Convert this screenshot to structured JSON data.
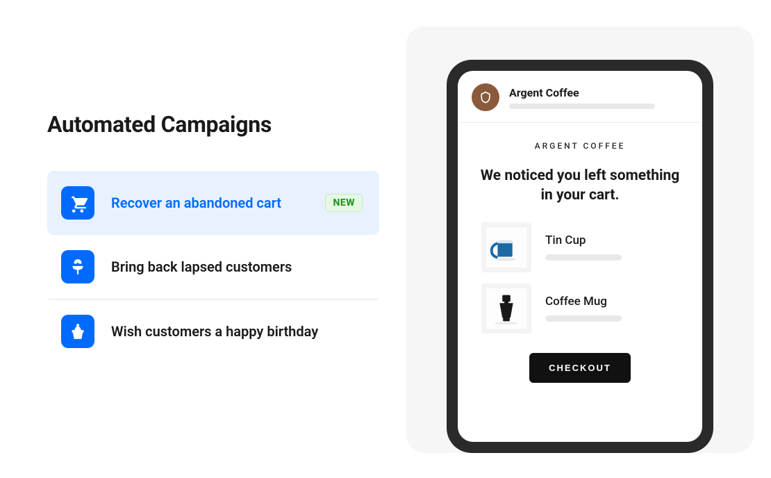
{
  "heading": "Automated Campaigns",
  "campaigns": [
    {
      "label": "Recover an abandoned cart",
      "icon": "cart",
      "badge": "NEW",
      "selected": true
    },
    {
      "label": "Bring back lapsed customers",
      "icon": "plant",
      "selected": false
    },
    {
      "label": "Wish customers a happy birthday",
      "icon": "cupcake",
      "selected": false
    }
  ],
  "preview": {
    "brand_name": "Argent Coffee",
    "brand_caption": "ARGENT COFFEE",
    "headline": "We noticed you left something in your cart.",
    "products": [
      {
        "name": "Tin Cup"
      },
      {
        "name": "Coffee Mug"
      }
    ],
    "cta": "CHECKOUT"
  },
  "colors": {
    "accent": "#006aff",
    "highlight_bg": "#e7f1ff",
    "badge_text": "#189212",
    "preview_bg": "#f6f6f6"
  }
}
